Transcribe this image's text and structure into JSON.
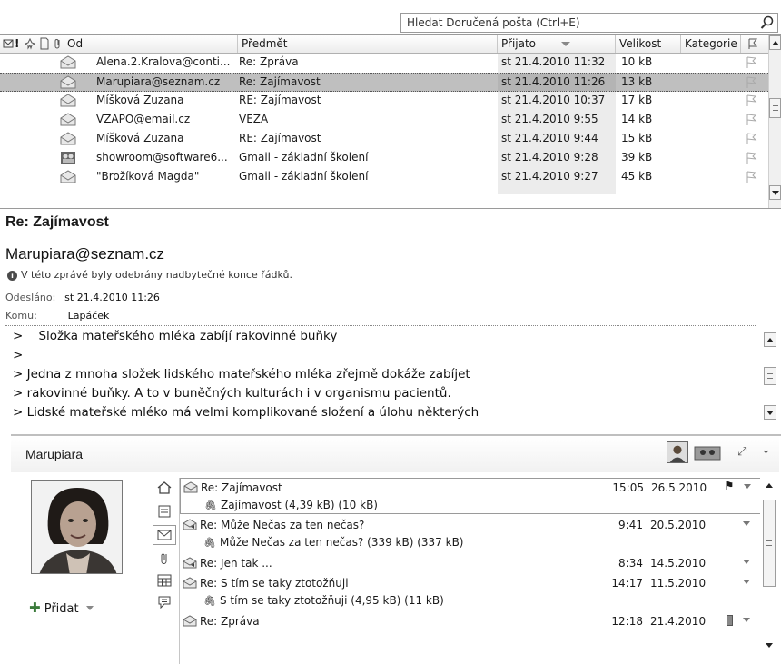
{
  "search": {
    "placeholder": "Hledat Doručená pošta (Ctrl+E)"
  },
  "list": {
    "columns": {
      "from": "Od",
      "subject": "Předmět",
      "received": "Přijato",
      "size": "Velikost",
      "category": "Kategorie"
    },
    "rows": [
      {
        "from": "Alena.2.Kralova@conti...",
        "subject": "Re: Zpráva",
        "received": "st 21.4.2010 11:32",
        "size": "10 kB",
        "icon": "envelope-open-icon"
      },
      {
        "from": "Marupiara@seznam.cz",
        "subject": "Re: Zajímavost",
        "received": "st 21.4.2010 11:26",
        "size": "13 kB",
        "icon": "envelope-open-icon",
        "selected": true
      },
      {
        "from": "Míšková Zuzana",
        "subject": "RE: Zajímavost",
        "received": "st 21.4.2010 10:37",
        "size": "17 kB",
        "icon": "envelope-open-icon"
      },
      {
        "from": "VZAPO@email.cz",
        "subject": "VEZA",
        "received": "st 21.4.2010 9:55",
        "size": "14 kB",
        "icon": "envelope-open-icon"
      },
      {
        "from": "Míšková Zuzana",
        "subject": "RE: Zajímavost",
        "received": "st 21.4.2010 9:44",
        "size": "15 kB",
        "icon": "envelope-open-icon"
      },
      {
        "from": "showroom@software6...",
        "subject": "Gmail - základní školení",
        "received": "st 21.4.2010 9:28",
        "size": "39 kB",
        "icon": "meeting-icon"
      },
      {
        "from": "\"Brožíková Magda\"",
        "subject": "Gmail - základní školení",
        "received": "st 21.4.2010 9:27",
        "size": "45 kB",
        "icon": "envelope-open-icon"
      }
    ]
  },
  "message": {
    "subject": "Re: Zajímavost",
    "from": "Marupiara@seznam.cz",
    "info": "V této zprávě byly odebrány nadbytečné konce řádků.",
    "sent_label": "Odesláno:",
    "sent_value": "st 21.4.2010 11:26",
    "to_label": "Komu:",
    "to_value": "Lapáček",
    "body": [
      ">    Složka mateřského mléka zabíjí rakovinné buňky",
      ">",
      "> Jedna z mnoha složek lidského mateřského mléka zřejmě dokáže zabíjet",
      "> rakovinné buňky. A to v buněčných kulturách i v organismu pacientů.",
      "> Lidské mateřské mléko má velmi komplikované složení a úlohu některých"
    ]
  },
  "people": {
    "name": "Marupiara",
    "add_label": "Přidat",
    "items": [
      {
        "title": "Re: Zajímavost",
        "attachment": "Zajímavost (4,39 kB) (10 kB)",
        "time": "15:05",
        "date": "26.5.2010",
        "flag": true,
        "selected": true
      },
      {
        "title": "Re: Může Nečas za ten nečas?",
        "attachment": "Může Nečas za ten nečas? (339 kB) (337 kB)",
        "time": "9:41",
        "date": "20.5.2010",
        "replied": true
      },
      {
        "title": "Re: Jen tak ...",
        "time": "8:34",
        "date": "14.5.2010",
        "replied": true
      },
      {
        "title": "Re: S tím se taky ztotožňuji",
        "attachment": "S tím se taky ztotožňuji (4,95 kB) (11 kB)",
        "time": "14:17",
        "date": "11.5.2010"
      },
      {
        "title": "Re: Zpráva",
        "time": "12:18",
        "date": "21.4.2010",
        "category": true
      }
    ]
  },
  "colors": {
    "selected_row": "#bfbfbf",
    "date_column": "#ececec"
  }
}
